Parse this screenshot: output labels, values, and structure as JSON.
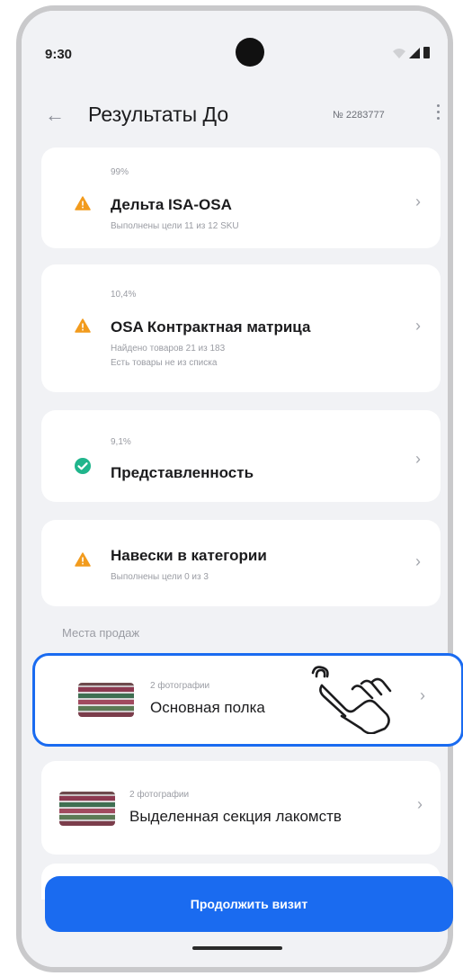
{
  "status_bar": {
    "time": "9:30"
  },
  "header": {
    "title": "Результаты До",
    "order_number": "№ 2283777"
  },
  "metrics": [
    {
      "percent": "99%",
      "title": "Дельта ISA-OSA",
      "subtitle": "Выполнены цели 11 из 12 SKU",
      "subtitle2": "",
      "status": "warning"
    },
    {
      "percent": "10,4%",
      "title": "OSA Контрактная матрица",
      "subtitle": "Найдено товаров 21 из 183",
      "subtitle2": "Есть товары не из списка",
      "status": "warning"
    },
    {
      "percent": "9,1%",
      "title": "Представленность",
      "subtitle": "",
      "subtitle2": "",
      "status": "ok"
    },
    {
      "percent": "",
      "title": "Навески в категории",
      "subtitle": "Выполнены цели 0 из 3",
      "subtitle2": "",
      "status": "warning"
    }
  ],
  "sales_places": {
    "label": "Места продаж",
    "items": [
      {
        "photos": "2 фотографии",
        "name": "Основная полка",
        "selected": true
      },
      {
        "photos": "2 фотографии",
        "name": "Выделенная секция лакомств",
        "selected": false
      }
    ]
  },
  "footer": {
    "continue_label": "Продолжить визит"
  },
  "icons": {
    "warning": "warning-triangle-icon",
    "ok": "check-circle-icon",
    "chevron": "chevron-right-icon",
    "back": "arrow-left-icon",
    "menu": "more-vertical-icon",
    "tap": "hand-tap-icon"
  },
  "colors": {
    "accent": "#1a6bf0",
    "warning": "#f29b1d",
    "ok": "#20b58c",
    "background": "#f1f2f5",
    "card": "#ffffff"
  }
}
